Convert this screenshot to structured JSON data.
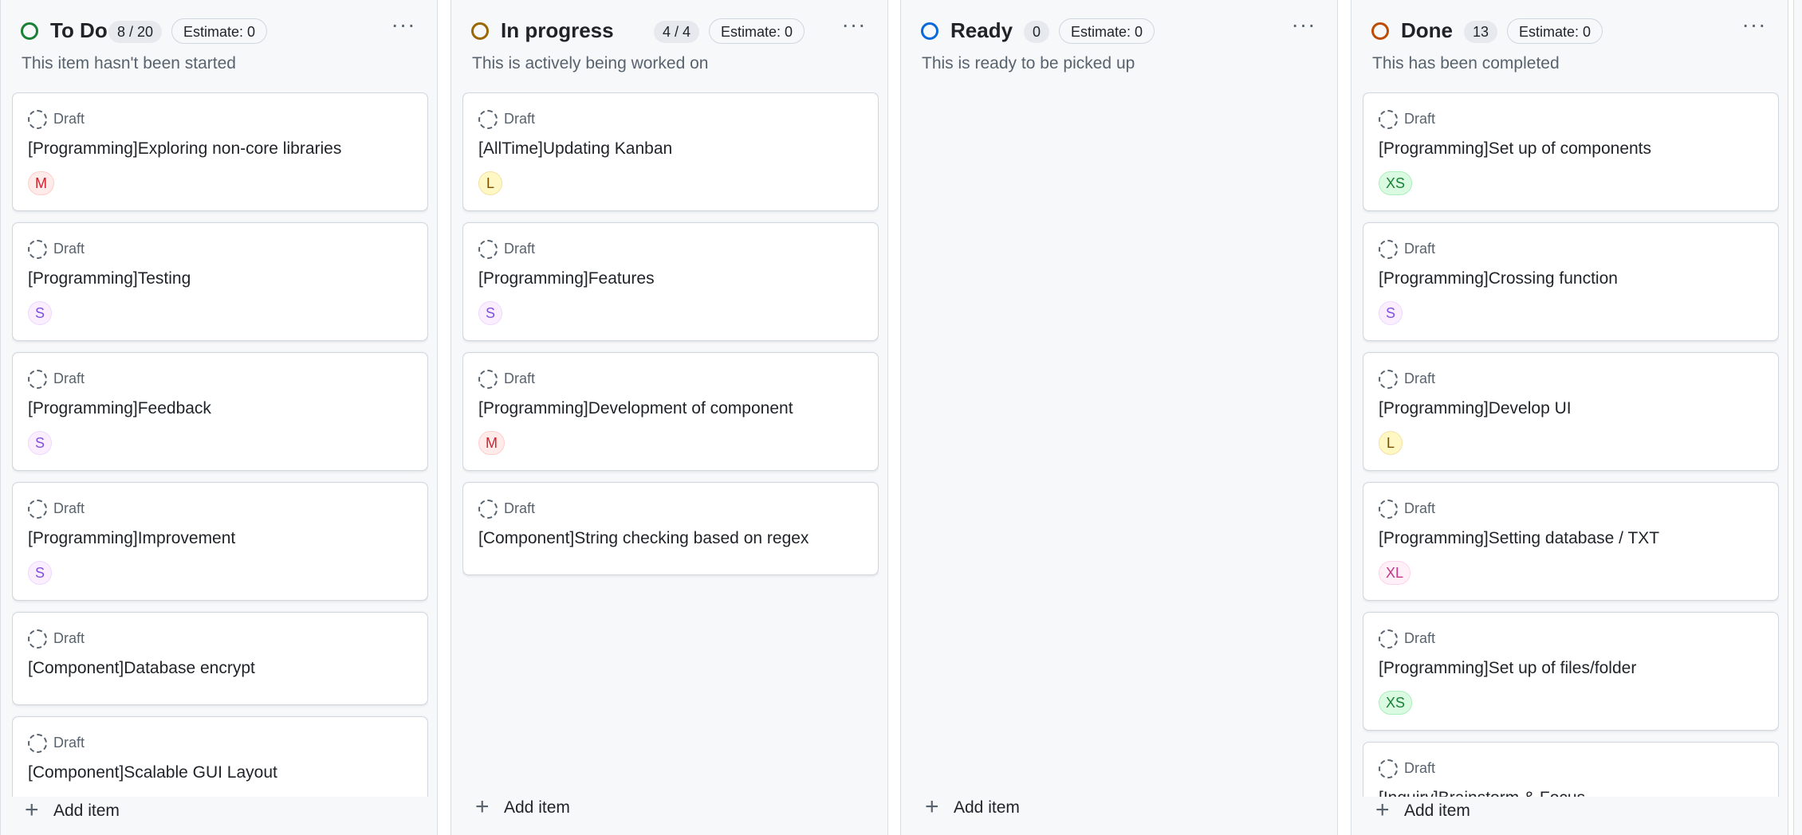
{
  "columns": [
    {
      "title": "To Do",
      "count": "8 / 20",
      "estimate": "Estimate: 0",
      "description": "This item hasn't been started",
      "status_color": "#1a7f37",
      "menu": "···",
      "add_item": "Add item",
      "cards": [
        {
          "draft": "Draft",
          "title": "[Programming]Exploring non-core libraries",
          "size": "M"
        },
        {
          "draft": "Draft",
          "title": "[Programming]Testing",
          "size": "S"
        },
        {
          "draft": "Draft",
          "title": "[Programming]Feedback",
          "size": "S"
        },
        {
          "draft": "Draft",
          "title": "[Programming]Improvement",
          "size": "S"
        },
        {
          "draft": "Draft",
          "title": "[Component]Database encrypt",
          "size": ""
        },
        {
          "draft": "Draft",
          "title": "[Component]Scalable GUI Layout",
          "size": ""
        }
      ]
    },
    {
      "title": "In progress",
      "count": "4 / 4",
      "estimate": "Estimate: 0",
      "description": "This is actively being worked on",
      "status_color": "#9a6700",
      "menu": "···",
      "add_item": "Add item",
      "cards": [
        {
          "draft": "Draft",
          "title": "[AllTime]Updating Kanban",
          "size": "L"
        },
        {
          "draft": "Draft",
          "title": "[Programming]Features",
          "size": "S"
        },
        {
          "draft": "Draft",
          "title": "[Programming]Development of component",
          "size": "M"
        },
        {
          "draft": "Draft",
          "title": "[Component]String checking based on regex",
          "size": ""
        }
      ]
    },
    {
      "title": "Ready",
      "count": "0",
      "estimate": "Estimate: 0",
      "description": "This is ready to be picked up",
      "status_color": "#0969da",
      "menu": "···",
      "add_item": "Add item",
      "cards": []
    },
    {
      "title": "Done",
      "count": "13",
      "estimate": "Estimate: 0",
      "description": "This has been completed",
      "status_color": "#bc4c00",
      "menu": "···",
      "add_item": "Add item",
      "cards": [
        {
          "draft": "Draft",
          "title": "[Programming]Set up of components",
          "size": "XS"
        },
        {
          "draft": "Draft",
          "title": "[Programming]Crossing function",
          "size": "S"
        },
        {
          "draft": "Draft",
          "title": "[Programming]Develop UI",
          "size": "L"
        },
        {
          "draft": "Draft",
          "title": "[Programming]Setting database / TXT",
          "size": "XL"
        },
        {
          "draft": "Draft",
          "title": "[Programming]Set up of files/folder",
          "size": "XS"
        },
        {
          "draft": "Draft",
          "title": "[Inquiry]Brainstorm & Focus",
          "size": ""
        }
      ]
    }
  ]
}
